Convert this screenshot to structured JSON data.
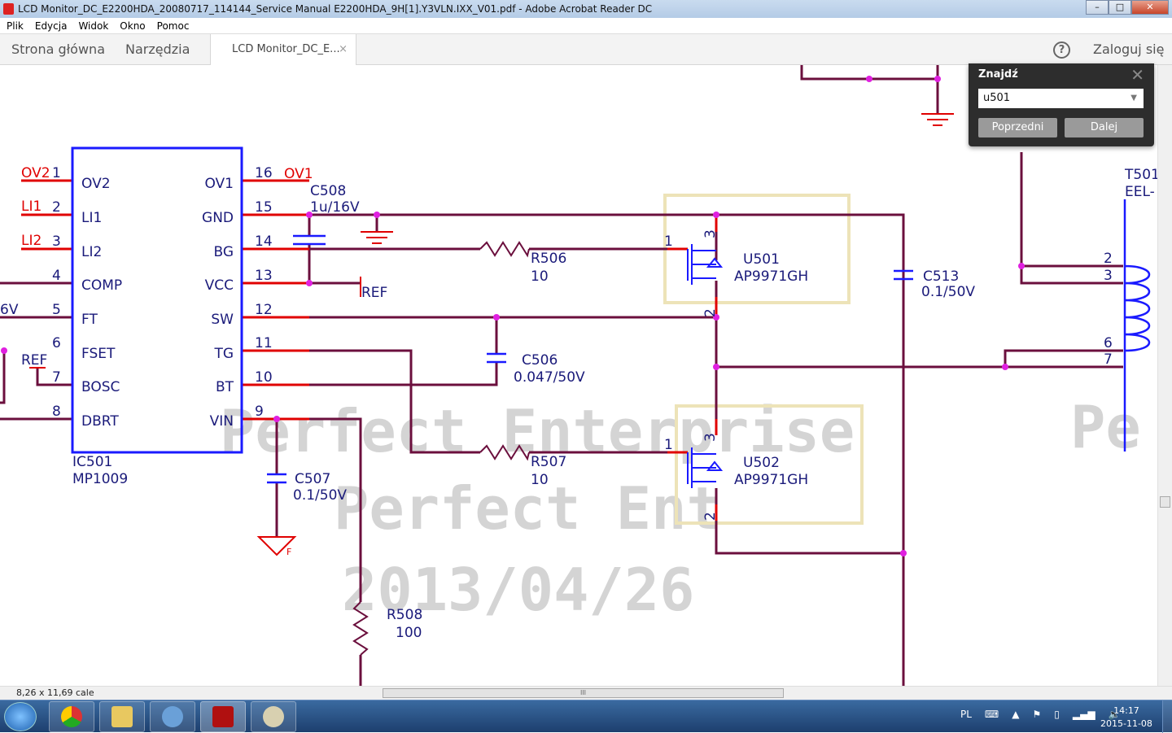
{
  "window": {
    "title": "LCD Monitor_DC_E2200HDA_20080717_114144_Service Manual E2200HDA_9H[1].Y3VLN.IXX_V01.pdf - Adobe Acrobat Reader DC",
    "minimize": "–",
    "maximize": "□",
    "close": "✕"
  },
  "menu": [
    "Plik",
    "Edycja",
    "Widok",
    "Okno",
    "Pomoc"
  ],
  "tabs": {
    "home": "Strona główna",
    "tools": "Narzędzia",
    "document": "LCD Monitor_DC_E...",
    "close": "×",
    "help": "?",
    "login": "Zaloguj się"
  },
  "find": {
    "title": "Znajdź",
    "close": "✕",
    "value": "u501",
    "dropdown": "▼",
    "prev": "Poprzedni",
    "next": "Dalej"
  },
  "schematic": {
    "ic": {
      "ref": "IC501",
      "part": "MP1009",
      "left_pins": [
        {
          "n": "1",
          "name": "OV2",
          "net": "OV2"
        },
        {
          "n": "2",
          "name": "LI1",
          "net": "LI1"
        },
        {
          "n": "3",
          "name": "LI2",
          "net": "LI2"
        },
        {
          "n": "4",
          "name": "COMP"
        },
        {
          "n": "5",
          "name": "FT",
          "net": "6V"
        },
        {
          "n": "6",
          "name": "FSET",
          "net": "REF"
        },
        {
          "n": "7",
          "name": "BOSC"
        },
        {
          "n": "8",
          "name": "DBRT"
        }
      ],
      "right_pins": [
        {
          "n": "16",
          "name": "OV1",
          "net": "OV1"
        },
        {
          "n": "15",
          "name": "GND"
        },
        {
          "n": "14",
          "name": "BG"
        },
        {
          "n": "13",
          "name": "VCC",
          "net": "REF"
        },
        {
          "n": "12",
          "name": "SW"
        },
        {
          "n": "11",
          "name": "TG"
        },
        {
          "n": "10",
          "name": "BT"
        },
        {
          "n": "9",
          "name": "VIN"
        }
      ]
    },
    "c508": {
      "ref": "C508",
      "val": "1u/16V"
    },
    "r506": {
      "ref": "R506",
      "val": "10"
    },
    "r507": {
      "ref": "R507",
      "val": "10"
    },
    "r508": {
      "ref": "R508",
      "val": "100"
    },
    "c506": {
      "ref": "C506",
      "val": "0.047/50V"
    },
    "c507": {
      "ref": "C507",
      "val": "0.1/50V"
    },
    "c513": {
      "ref": "C513",
      "val": "0.1/50V"
    },
    "u501": {
      "ref": "U501",
      "part": "AP9971GH",
      "p1": "1",
      "p2": "2",
      "p3": "3"
    },
    "u502": {
      "ref": "U502",
      "part": "AP9971GH",
      "p1": "1",
      "p2": "2",
      "p3": "3"
    },
    "t501": {
      "ref": "T501",
      "part": "EEL-",
      "pins": [
        "2",
        "3",
        "6",
        "7"
      ]
    },
    "gnd_f": "F",
    "watermark": [
      "Perfect Enterprise",
      "Perfect Ent",
      "2013/04/26",
      "Pe"
    ]
  },
  "status": {
    "page_size": "8,26 x 11,69 cale",
    "scroll_grip": "III"
  },
  "tray": {
    "lang": "PL",
    "time": "14:17",
    "date": "2015-11-08"
  },
  "colors": {
    "wire": "#6b0f3d",
    "pin": "#e00000",
    "ic_box": "#1a1aff",
    "highlight": "#ede3b8",
    "junction": "#e020e0"
  }
}
